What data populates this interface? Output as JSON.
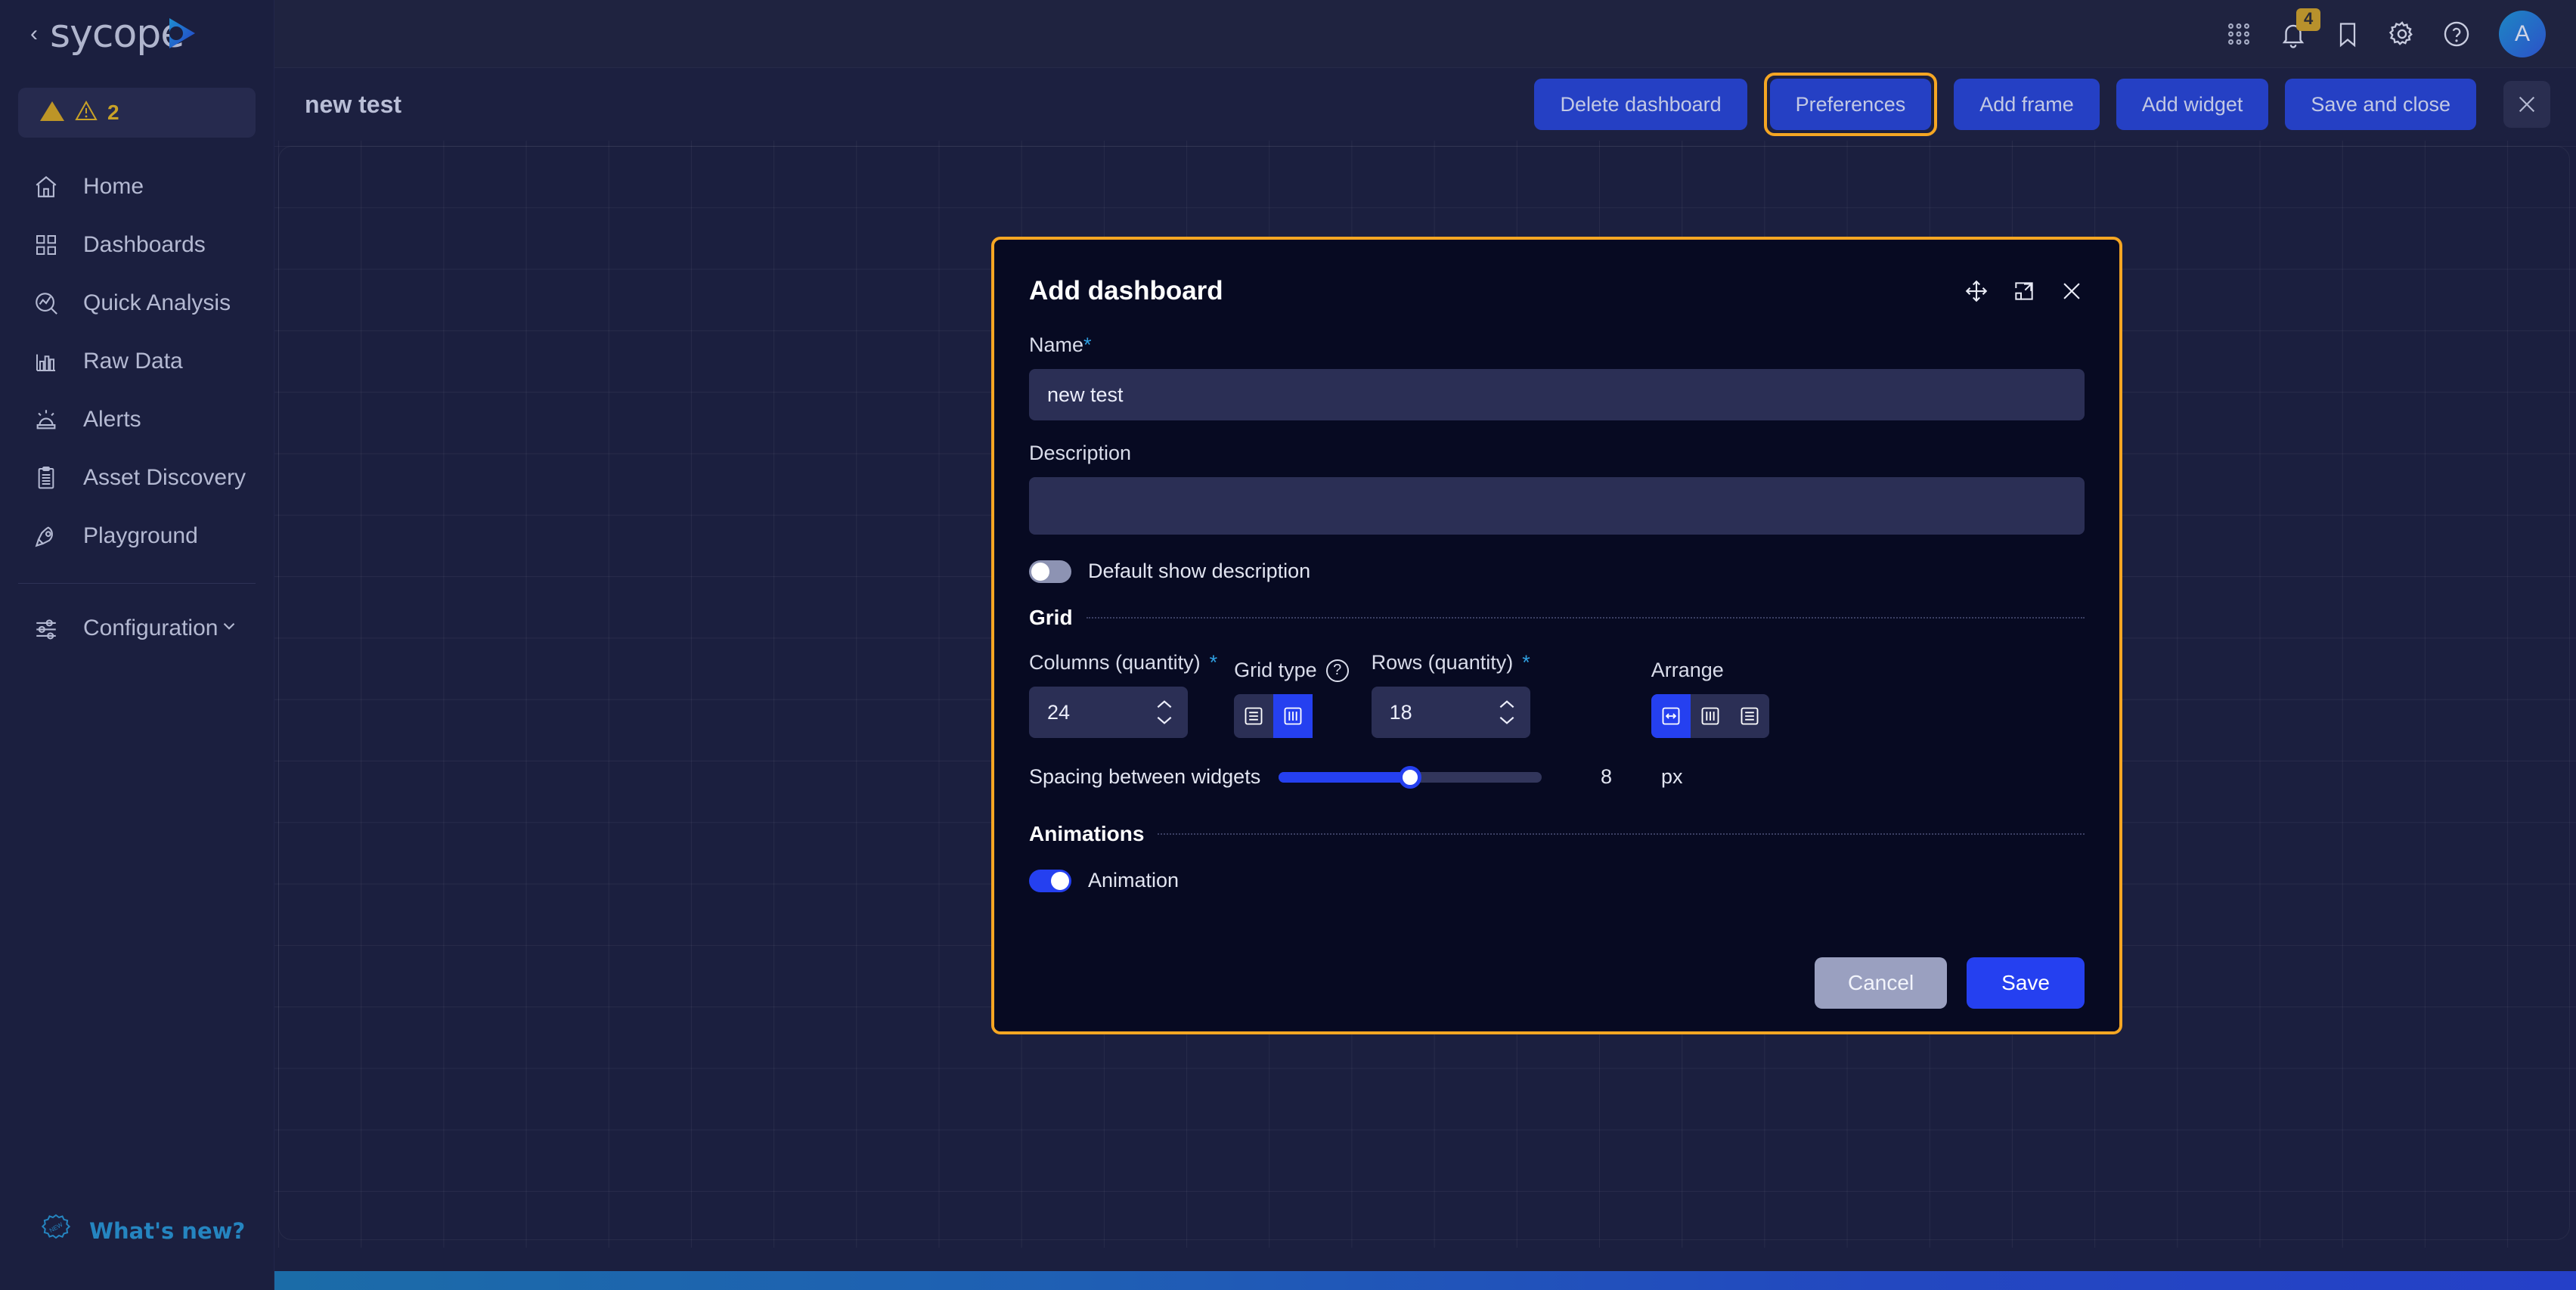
{
  "app": {
    "brand": "sycope",
    "collapse_icon": "chevron-left-icon",
    "logo_icon": "sycope-play-logo"
  },
  "sidebar": {
    "alert": {
      "count": "2",
      "icon": "warning-triangle-icon"
    },
    "items": [
      {
        "label": "Home",
        "icon": "home-icon"
      },
      {
        "label": "Dashboards",
        "icon": "grid-squares-icon"
      },
      {
        "label": "Quick Analysis",
        "icon": "magnifier-chart-icon"
      },
      {
        "label": "Raw Data",
        "icon": "bar-chart-icon"
      },
      {
        "label": "Alerts",
        "icon": "siren-icon"
      },
      {
        "label": "Asset Discovery",
        "icon": "clipboard-list-icon"
      },
      {
        "label": "Playground",
        "icon": "rocket-icon"
      }
    ],
    "configuration": {
      "label": "Configuration",
      "icon": "sliders-icon",
      "chevron": "chevron-down-icon"
    },
    "whats_new": {
      "label": "What's new?",
      "icon": "new-badge-icon",
      "color": "#2585c0"
    }
  },
  "topbar": {
    "icons": [
      {
        "name": "apps-grid-icon"
      },
      {
        "name": "bell-icon",
        "badge": "4"
      },
      {
        "name": "bookmark-icon"
      },
      {
        "name": "gear-icon"
      },
      {
        "name": "help-circle-icon"
      }
    ],
    "avatar": {
      "initial": "A"
    }
  },
  "toolbar": {
    "title": "new test",
    "delete_label": "Delete dashboard",
    "preferences_label": "Preferences",
    "add_frame_label": "Add frame",
    "add_widget_label": "Add widget",
    "save_close_label": "Save and close",
    "close_icon": "close-icon",
    "focus_color": "#f5a623",
    "button_color": "#2540c4"
  },
  "modal": {
    "title": "Add dashboard",
    "header_icons": [
      {
        "name": "move-arrows-icon"
      },
      {
        "name": "maximize-icon"
      },
      {
        "name": "close-icon"
      }
    ],
    "border_color": "#f5a623",
    "name": {
      "label": "Name",
      "required": "*",
      "value": "new test",
      "placeholder": ""
    },
    "description": {
      "label": "Description",
      "value": "",
      "placeholder": ""
    },
    "default_show_description": {
      "label": "Default show description",
      "on": false
    },
    "grid_section": {
      "title": "Grid",
      "columns": {
        "label": "Columns (quantity)",
        "required": "*",
        "value": "24"
      },
      "grid_type": {
        "label": "Grid type",
        "help_icon": "help-circle-icon",
        "options": [
          {
            "name": "rows-layout-icon",
            "active": false
          },
          {
            "name": "columns-layout-icon",
            "active": true
          }
        ]
      },
      "rows": {
        "label": "Rows (quantity)",
        "required": "*",
        "value": "18"
      },
      "arrange": {
        "label": "Arrange",
        "options": [
          {
            "name": "horizontal-resize-icon",
            "active": true
          },
          {
            "name": "columns-layout-icon",
            "active": false
          },
          {
            "name": "rows-layout-icon",
            "active": false
          }
        ]
      },
      "spacing": {
        "label": "Spacing between widgets",
        "value": "8",
        "unit": "px",
        "percent": 50
      }
    },
    "animations_section": {
      "title": "Animations",
      "animation_toggle": {
        "label": "Animation",
        "on": true
      }
    },
    "footer": {
      "cancel_label": "Cancel",
      "save_label": "Save"
    }
  }
}
